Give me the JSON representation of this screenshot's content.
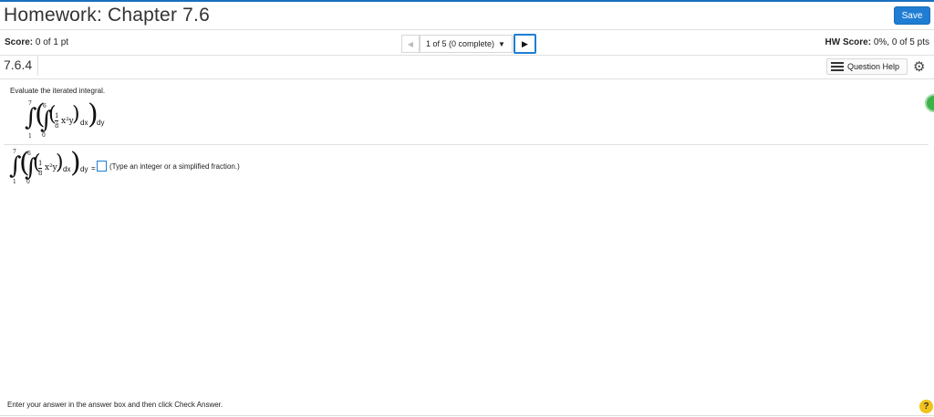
{
  "header": {
    "title": "Homework: Chapter 7.6",
    "save_label": "Save"
  },
  "score_bar": {
    "score_label": "Score:",
    "score_value": "0 of 1 pt",
    "nav_prev_icon": "triangle-left-icon",
    "question_selector": "1 of 5 (0 complete)",
    "nav_next_icon": "triangle-right-icon",
    "hw_score_label": "HW Score:",
    "hw_score_value": "0%, 0 of 5 pts"
  },
  "question": {
    "number": "7.6.4",
    "help_label": "Question Help",
    "instruction": "Evaluate the iterated integral.",
    "integral": {
      "outer_lower": "1",
      "outer_upper": "7",
      "inner_lower": "0",
      "inner_upper": "6",
      "frac_num": "1",
      "frac_den": "8",
      "expr": "x²y",
      "dx": "dx",
      "dy": "dy",
      "equals": "="
    },
    "answer_hint": "(Type an integer or a simplified fraction.)"
  },
  "footer": {
    "instruction": "Enter your answer in the answer box and then click Check Answer.",
    "help_icon": "?"
  }
}
